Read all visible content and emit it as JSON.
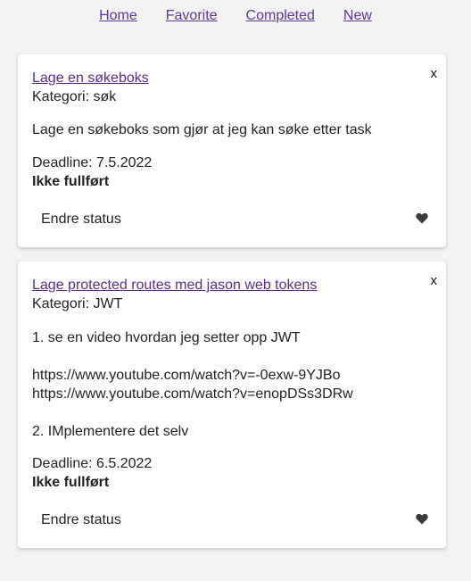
{
  "nav": {
    "home": "Home",
    "favorite": "Favorite",
    "completed": "Completed",
    "new": "New"
  },
  "tasks": [
    {
      "close": "x",
      "title": "Lage en søkeboks",
      "category": "Kategori: søk",
      "description": "Lage en søkeboks som gjør at jeg kan søke etter task",
      "deadline": "Deadline: 7.5.2022",
      "status": "Ikke fullført",
      "action": "Endre status",
      "icon": "heart-icon"
    },
    {
      "close": "x",
      "title": "Lage protected routes med jason web tokens",
      "category": "Kategori: JWT",
      "description": "1. se en video hvordan jeg setter opp JWT\n\nhttps://www.youtube.com/watch?v=-0exw-9YJBo\nhttps://www.youtube.com/watch?v=enopDSs3DRw\n\n2. IMplementere det selv",
      "deadline": "Deadline: 6.5.2022",
      "status": "Ikke fullført",
      "action": "Endre status",
      "icon": "heart-icon"
    }
  ],
  "colors": {
    "link": "#5a2e8a",
    "background": "#f3f3f3",
    "card": "#ffffff"
  }
}
